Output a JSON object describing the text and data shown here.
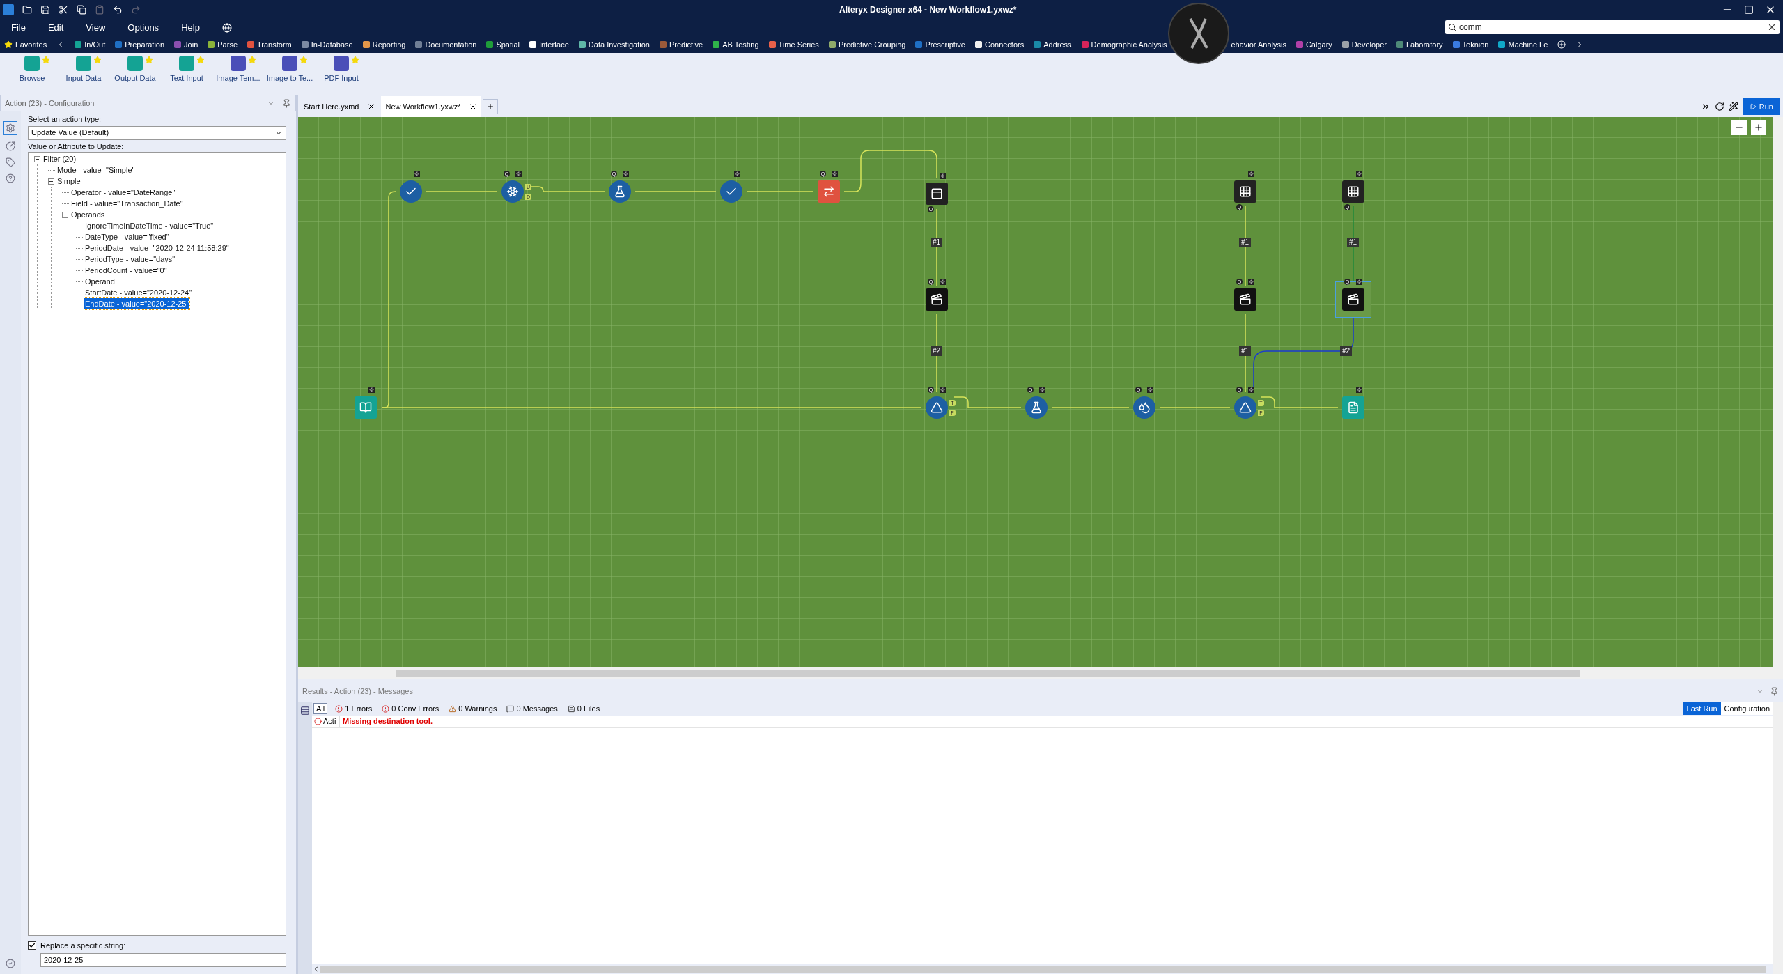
{
  "window": {
    "title": "Alteryx Designer x64 - New Workflow1.yxwz*"
  },
  "menu": [
    "File",
    "Edit",
    "View",
    "Options",
    "Help"
  ],
  "search": {
    "value": "comm"
  },
  "categories": [
    {
      "label": "Favorites",
      "color": "#f5d90a"
    },
    {
      "label": "In/Out",
      "color": "#14a394"
    },
    {
      "label": "Preparation",
      "color": "#1f6fc4"
    },
    {
      "label": "Join",
      "color": "#8a4fb0"
    },
    {
      "label": "Parse",
      "color": "#8bb33a"
    },
    {
      "label": "Transform",
      "color": "#e0523f"
    },
    {
      "label": "In-Database",
      "color": "#7c8aa3"
    },
    {
      "label": "Reporting",
      "color": "#e3964a"
    },
    {
      "label": "Documentation",
      "color": "#6f7e96"
    },
    {
      "label": "Spatial",
      "color": "#1f9c3a"
    },
    {
      "label": "Interface",
      "color": "#ffffff"
    },
    {
      "label": "Data Investigation",
      "color": "#5fb8a8"
    },
    {
      "label": "Predictive",
      "color": "#9c5a3a"
    },
    {
      "label": "AB Testing",
      "color": "#2fb34a"
    },
    {
      "label": "Time Series",
      "color": "#e8604a"
    },
    {
      "label": "Predictive Grouping",
      "color": "#8faa6a"
    },
    {
      "label": "Prescriptive",
      "color": "#1f6fc4"
    },
    {
      "label": "Connectors",
      "color": "#f0f0f0"
    },
    {
      "label": "Address",
      "color": "#1a8aa8"
    },
    {
      "label": "Demographic Analysis",
      "color": "#d6245a"
    },
    {
      "label": "ehavior Analysis"
    },
    {
      "label": "Calgary",
      "color": "#b040a8"
    },
    {
      "label": "Developer",
      "color": "#9aa0a8"
    },
    {
      "label": "Laboratory",
      "color": "#4e8a78"
    },
    {
      "label": "Teknion",
      "color": "#3a7ae0"
    },
    {
      "label": "Machine Le",
      "color": "#10a8c8"
    }
  ],
  "tools": [
    {
      "label": "Browse",
      "color": "#14a394",
      "favorite": true
    },
    {
      "label": "Input Data",
      "color": "#14a394",
      "favorite": true
    },
    {
      "label": "Output Data",
      "color": "#14a394",
      "favorite": true
    },
    {
      "label": "Text Input",
      "color": "#14a394",
      "favorite": true
    },
    {
      "label": "Image Tem...",
      "color": "#4a4fb8",
      "favorite": true
    },
    {
      "label": "Image to Te...",
      "color": "#4a4fb8",
      "favorite": true
    },
    {
      "label": "PDF Input",
      "color": "#4a4fb8",
      "favorite": true
    }
  ],
  "config": {
    "title": "Action (23) - Configuration",
    "action_label": "Select an action type:",
    "action_value": "Update Value (Default)",
    "tree_label": "Value or Attribute to Update:",
    "tree": [
      {
        "label": "Filter (20)",
        "expanded": true,
        "selected": false,
        "children": [
          {
            "label": "Mode - value=\"Simple\"",
            "selected": false
          },
          {
            "label": "Simple",
            "expanded": true,
            "selected": false,
            "children": [
              {
                "label": "Operator - value=\"DateRange\"",
                "selected": false
              },
              {
                "label": "Field - value=\"Transaction_Date\"",
                "selected": false
              },
              {
                "label": "Operands",
                "expanded": true,
                "selected": false,
                "children": [
                  {
                    "label": "IgnoreTimeInDateTime - value=\"True\"",
                    "selected": false
                  },
                  {
                    "label": "DateType - value=\"fixed\"",
                    "selected": false
                  },
                  {
                    "label": "PeriodDate - value=\"2020-12-24 11:58:29\"",
                    "selected": false
                  },
                  {
                    "label": "PeriodType - value=\"days\"",
                    "selected": false
                  },
                  {
                    "label": "PeriodCount - value=\"0\"",
                    "selected": false
                  },
                  {
                    "label": "Operand",
                    "selected": false
                  },
                  {
                    "label": "StartDate - value=\"2020-12-24\"",
                    "selected": false
                  },
                  {
                    "label": "EndDate - value=\"2020-12-25\"",
                    "selected": true
                  }
                ]
              }
            ]
          }
        ]
      }
    ],
    "replace": {
      "label": "Replace a specific string:",
      "checked": true,
      "value": "2020-12-25"
    }
  },
  "tabs": [
    {
      "label": "Start Here.yxmd",
      "selected": false
    },
    {
      "label": "New Workflow1.yxwz*",
      "selected": true
    }
  ],
  "run_button": "Run",
  "canvas": {
    "nodes": [
      {
        "kind": "select",
        "selected": false
      },
      {
        "kind": "cleanse",
        "badge": "Q",
        "outputs": [
          "U",
          "D"
        ],
        "selected": false
      },
      {
        "kind": "formula",
        "badge": "Q",
        "selected": false
      },
      {
        "kind": "select",
        "selected": false
      },
      {
        "kind": "transpose",
        "badge": "Q",
        "selected": false
      },
      {
        "kind": "dropdown",
        "badge": "Q",
        "selected": false
      },
      {
        "kind": "table",
        "badge": "Q",
        "selected": false
      },
      {
        "kind": "table",
        "badge": "Q",
        "selected": false
      },
      {
        "kind": "action",
        "badge": "Q",
        "selected": false
      },
      {
        "kind": "action",
        "badge": "Q",
        "selected": false
      },
      {
        "kind": "action",
        "badge": "Q",
        "selected": true
      },
      {
        "kind": "input",
        "selected": false
      },
      {
        "kind": "filter",
        "badge": "Q",
        "outputs": [
          "T",
          "F"
        ],
        "selected": false
      },
      {
        "kind": "formula",
        "badge": "Q",
        "selected": false
      },
      {
        "kind": "water",
        "badge": "Q",
        "selected": false
      },
      {
        "kind": "filter",
        "badge": "Q",
        "outputs": [
          "T",
          "F"
        ],
        "selected": false
      },
      {
        "kind": "output",
        "selected": false
      }
    ],
    "connection_labels": [
      "#1",
      "#1",
      "#1",
      "#2",
      "#1",
      "#2"
    ]
  },
  "results": {
    "title": "Results - Action (23) - Messages",
    "filters": [
      {
        "label": "All",
        "kind": "all",
        "selected": true
      },
      {
        "label": "1 Errors",
        "kind": "error",
        "selected": false
      },
      {
        "label": "0 Conv Errors",
        "kind": "error",
        "selected": false
      },
      {
        "label": "0 Warnings",
        "kind": "warning",
        "selected": false
      },
      {
        "label": "0 Messages",
        "kind": "message",
        "selected": false
      },
      {
        "label": "0 Files",
        "kind": "file",
        "selected": false
      }
    ],
    "views": [
      {
        "label": "Last Run",
        "selected": true
      },
      {
        "label": "Configuration",
        "selected": false
      }
    ],
    "messages": [
      {
        "kind": "error",
        "tool": "Acti",
        "text": "Missing destination tool."
      }
    ]
  }
}
